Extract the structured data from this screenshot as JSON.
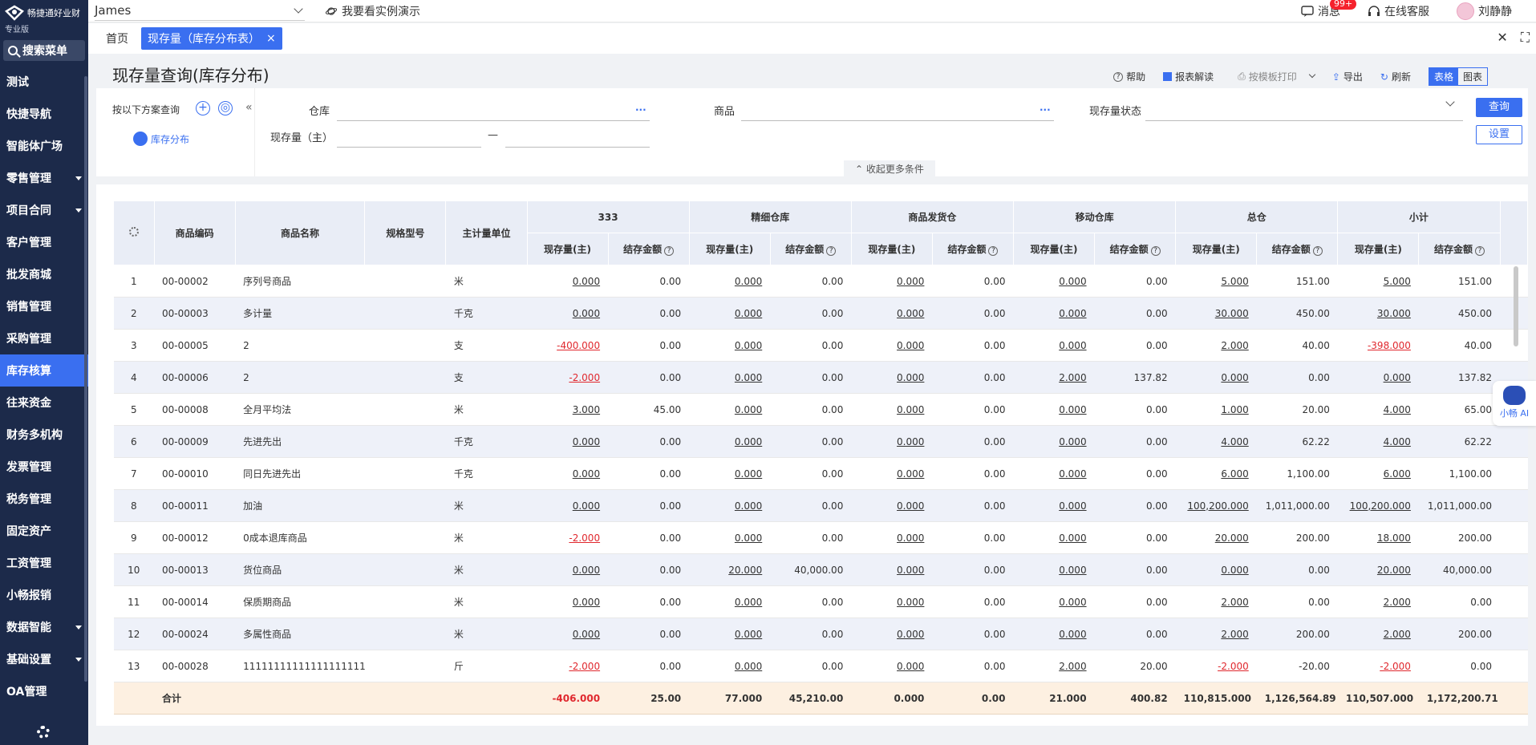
{
  "app": {
    "logo_text": "畅捷通好业财",
    "edition": "专业版",
    "search_menu": "搜索菜单",
    "company": "James",
    "demo": "我要看实例演示",
    "messages": "消息",
    "messages_badge": "99+",
    "service": "在线客服",
    "user": "刘静静"
  },
  "sidebar": {
    "items": [
      {
        "label": "测试",
        "caret": false
      },
      {
        "label": "快捷导航",
        "caret": false
      },
      {
        "label": "智能体广场",
        "caret": false
      },
      {
        "label": "零售管理",
        "caret": true
      },
      {
        "label": "项目合同",
        "caret": true
      },
      {
        "label": "客户管理",
        "caret": false
      },
      {
        "label": "批发商城",
        "caret": false
      },
      {
        "label": "销售管理",
        "caret": false
      },
      {
        "label": "采购管理",
        "caret": false
      },
      {
        "label": "库存核算",
        "caret": false,
        "active": true
      },
      {
        "label": "往来资金",
        "caret": false
      },
      {
        "label": "财务多机构",
        "caret": false
      },
      {
        "label": "发票管理",
        "caret": false
      },
      {
        "label": "税务管理",
        "caret": false
      },
      {
        "label": "固定资产",
        "caret": false
      },
      {
        "label": "工资管理",
        "caret": false
      },
      {
        "label": "小畅报销",
        "caret": false
      },
      {
        "label": "数据智能",
        "caret": true
      },
      {
        "label": "基础设置",
        "caret": true
      },
      {
        "label": "OA管理",
        "caret": false
      }
    ]
  },
  "tabs": {
    "home": "首页",
    "active": "现存量（库存分布表）",
    "close": "×",
    "win_close": "✕",
    "win_expand": "⛶"
  },
  "page": {
    "title": "现存量查询(库存分布)",
    "toolbar": {
      "help": "帮助",
      "interpret": "报表解读",
      "print_template": "按模板打印",
      "export": "导出",
      "refresh": "刷新",
      "view_table": "表格",
      "view_chart": "图表"
    }
  },
  "filter": {
    "scheme_title": "按以下方案查询",
    "scheme_item": "库存分布",
    "warehouse_label": "仓库",
    "product_label": "商品",
    "status_label": "现存量状态",
    "qty_label": "现存量（主）",
    "range_sep": "—",
    "query_button": "查询",
    "settings_button": "设置",
    "more_conditions": "收起更多条件",
    "ellipsis": "···",
    "add_icon": "+",
    "collapse_icon": "«"
  },
  "table": {
    "fixed_headers": [
      "商品编码",
      "商品名称",
      "规格型号",
      "主计量单位"
    ],
    "groups": [
      "333",
      "精细仓库",
      "商品发货仓",
      "移动仓库",
      "总仓",
      "小计"
    ],
    "sub_qty": "现存量(主)",
    "sub_amt": "结存金额",
    "help_mark": "?",
    "rows": [
      {
        "no": "1",
        "code": "00-00002",
        "name": "序列号商品",
        "spec": "",
        "unit": "米",
        "cells": [
          [
            "0.000",
            "0.00"
          ],
          [
            "0.000",
            "0.00"
          ],
          [
            "0.000",
            "0.00"
          ],
          [
            "0.000",
            "0.00"
          ],
          [
            "5.000",
            "151.00"
          ],
          [
            "5.000",
            "151.00"
          ]
        ]
      },
      {
        "no": "2",
        "code": "00-00003",
        "name": "多计量",
        "spec": "",
        "unit": "千克",
        "cells": [
          [
            "0.000",
            "0.00"
          ],
          [
            "0.000",
            "0.00"
          ],
          [
            "0.000",
            "0.00"
          ],
          [
            "0.000",
            "0.00"
          ],
          [
            "30.000",
            "450.00"
          ],
          [
            "30.000",
            "450.00"
          ]
        ]
      },
      {
        "no": "3",
        "code": "00-00005",
        "name": "2",
        "spec": "",
        "unit": "支",
        "cells": [
          [
            "-400.000",
            "0.00"
          ],
          [
            "0.000",
            "0.00"
          ],
          [
            "0.000",
            "0.00"
          ],
          [
            "0.000",
            "0.00"
          ],
          [
            "2.000",
            "40.00"
          ],
          [
            "-398.000",
            "40.00"
          ]
        ]
      },
      {
        "no": "4",
        "code": "00-00006",
        "name": "2",
        "spec": "",
        "unit": "支",
        "cells": [
          [
            "-2.000",
            "0.00"
          ],
          [
            "0.000",
            "0.00"
          ],
          [
            "0.000",
            "0.00"
          ],
          [
            "2.000",
            "137.82"
          ],
          [
            "0.000",
            "0.00"
          ],
          [
            "0.000",
            "137.82"
          ]
        ]
      },
      {
        "no": "5",
        "code": "00-00008",
        "name": "全月平均法",
        "spec": "",
        "unit": "米",
        "cells": [
          [
            "3.000",
            "45.00"
          ],
          [
            "0.000",
            "0.00"
          ],
          [
            "0.000",
            "0.00"
          ],
          [
            "0.000",
            "0.00"
          ],
          [
            "1.000",
            "20.00"
          ],
          [
            "4.000",
            "65.00"
          ]
        ]
      },
      {
        "no": "6",
        "code": "00-00009",
        "name": "先进先出",
        "spec": "",
        "unit": "千克",
        "cells": [
          [
            "0.000",
            "0.00"
          ],
          [
            "0.000",
            "0.00"
          ],
          [
            "0.000",
            "0.00"
          ],
          [
            "0.000",
            "0.00"
          ],
          [
            "4.000",
            "62.22"
          ],
          [
            "4.000",
            "62.22"
          ]
        ]
      },
      {
        "no": "7",
        "code": "00-00010",
        "name": "同日先进先出",
        "spec": "",
        "unit": "千克",
        "cells": [
          [
            "0.000",
            "0.00"
          ],
          [
            "0.000",
            "0.00"
          ],
          [
            "0.000",
            "0.00"
          ],
          [
            "0.000",
            "0.00"
          ],
          [
            "6.000",
            "1,100.00"
          ],
          [
            "6.000",
            "1,100.00"
          ]
        ]
      },
      {
        "no": "8",
        "code": "00-00011",
        "name": "加油",
        "spec": "",
        "unit": "米",
        "cells": [
          [
            "0.000",
            "0.00"
          ],
          [
            "0.000",
            "0.00"
          ],
          [
            "0.000",
            "0.00"
          ],
          [
            "0.000",
            "0.00"
          ],
          [
            "100,200.000",
            "1,011,000.00"
          ],
          [
            "100,200.000",
            "1,011,000.00"
          ]
        ]
      },
      {
        "no": "9",
        "code": "00-00012",
        "name": "0成本退库商品",
        "spec": "",
        "unit": "米",
        "cells": [
          [
            "-2.000",
            "0.00"
          ],
          [
            "0.000",
            "0.00"
          ],
          [
            "0.000",
            "0.00"
          ],
          [
            "0.000",
            "0.00"
          ],
          [
            "20.000",
            "200.00"
          ],
          [
            "18.000",
            "200.00"
          ]
        ]
      },
      {
        "no": "10",
        "code": "00-00013",
        "name": "货位商品",
        "spec": "",
        "unit": "米",
        "cells": [
          [
            "0.000",
            "0.00"
          ],
          [
            "20.000",
            "40,000.00"
          ],
          [
            "0.000",
            "0.00"
          ],
          [
            "0.000",
            "0.00"
          ],
          [
            "0.000",
            "0.00"
          ],
          [
            "20.000",
            "40,000.00"
          ]
        ]
      },
      {
        "no": "11",
        "code": "00-00014",
        "name": "保质期商品",
        "spec": "",
        "unit": "米",
        "cells": [
          [
            "0.000",
            "0.00"
          ],
          [
            "0.000",
            "0.00"
          ],
          [
            "0.000",
            "0.00"
          ],
          [
            "0.000",
            "0.00"
          ],
          [
            "2.000",
            "0.00"
          ],
          [
            "2.000",
            "0.00"
          ]
        ]
      },
      {
        "no": "12",
        "code": "00-00024",
        "name": "多属性商品",
        "spec": "",
        "unit": "米",
        "cells": [
          [
            "0.000",
            "0.00"
          ],
          [
            "0.000",
            "0.00"
          ],
          [
            "0.000",
            "0.00"
          ],
          [
            "0.000",
            "0.00"
          ],
          [
            "2.000",
            "200.00"
          ],
          [
            "2.000",
            "200.00"
          ]
        ]
      },
      {
        "no": "13",
        "code": "00-00028",
        "name": "11111111111111111111111...",
        "spec": "",
        "unit": "斤",
        "cells": [
          [
            "-2.000",
            "0.00"
          ],
          [
            "0.000",
            "0.00"
          ],
          [
            "0.000",
            "0.00"
          ],
          [
            "2.000",
            "20.00"
          ],
          [
            "-2.000",
            "-20.00"
          ],
          [
            "-2.000",
            "0.00"
          ]
        ]
      }
    ],
    "total": {
      "label": "合计",
      "cells": [
        [
          "-406.000",
          "25.00"
        ],
        [
          "77.000",
          "45,210.00"
        ],
        [
          "0.000",
          "0.00"
        ],
        [
          "21.000",
          "400.82"
        ],
        [
          "110,815.000",
          "1,126,564.89"
        ],
        [
          "110,507.000",
          "1,172,200.71"
        ]
      ]
    }
  },
  "ai": {
    "label": "小畅 AI"
  }
}
